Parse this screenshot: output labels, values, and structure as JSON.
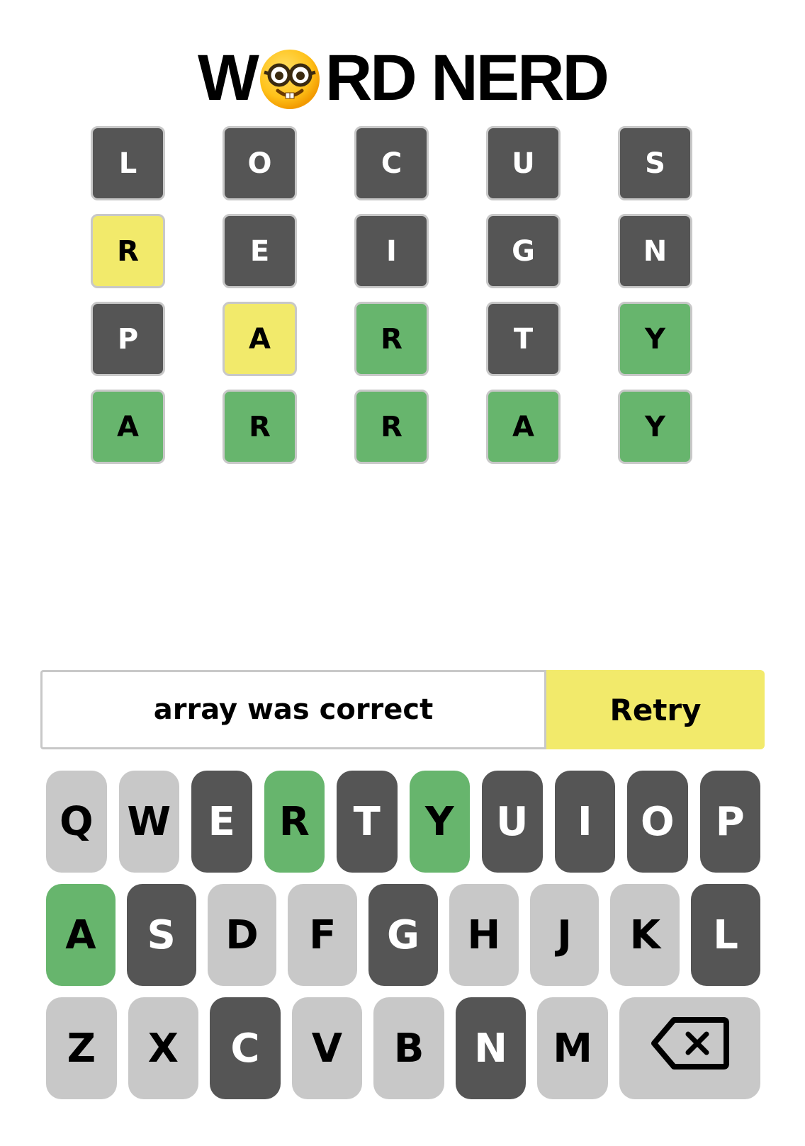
{
  "title": {
    "prefix": "W",
    "suffix": "RD NERD",
    "emoji_icon": "nerd-face-icon"
  },
  "colors": {
    "absent": "#555555",
    "present": "#f2ea6b",
    "correct": "#67b56d",
    "unused": "#c8c8c8"
  },
  "board": [
    [
      {
        "letter": "L",
        "state": "absent"
      },
      {
        "letter": "O",
        "state": "absent"
      },
      {
        "letter": "C",
        "state": "absent"
      },
      {
        "letter": "U",
        "state": "absent"
      },
      {
        "letter": "S",
        "state": "absent"
      }
    ],
    [
      {
        "letter": "R",
        "state": "present"
      },
      {
        "letter": "E",
        "state": "absent"
      },
      {
        "letter": "I",
        "state": "absent"
      },
      {
        "letter": "G",
        "state": "absent"
      },
      {
        "letter": "N",
        "state": "absent"
      }
    ],
    [
      {
        "letter": "P",
        "state": "absent"
      },
      {
        "letter": "A",
        "state": "present"
      },
      {
        "letter": "R",
        "state": "correct"
      },
      {
        "letter": "T",
        "state": "absent"
      },
      {
        "letter": "Y",
        "state": "correct"
      }
    ],
    [
      {
        "letter": "A",
        "state": "correct"
      },
      {
        "letter": "R",
        "state": "correct"
      },
      {
        "letter": "R",
        "state": "correct"
      },
      {
        "letter": "A",
        "state": "correct"
      },
      {
        "letter": "Y",
        "state": "correct"
      }
    ]
  ],
  "status": {
    "message": "array was correct",
    "retry_label": "Retry"
  },
  "keyboard": [
    [
      {
        "key": "Q",
        "state": "unused"
      },
      {
        "key": "W",
        "state": "unused"
      },
      {
        "key": "E",
        "state": "absent"
      },
      {
        "key": "R",
        "state": "correct"
      },
      {
        "key": "T",
        "state": "absent"
      },
      {
        "key": "Y",
        "state": "correct"
      },
      {
        "key": "U",
        "state": "absent"
      },
      {
        "key": "I",
        "state": "absent"
      },
      {
        "key": "O",
        "state": "absent"
      },
      {
        "key": "P",
        "state": "absent"
      }
    ],
    [
      {
        "key": "A",
        "state": "correct"
      },
      {
        "key": "S",
        "state": "absent"
      },
      {
        "key": "D",
        "state": "unused"
      },
      {
        "key": "F",
        "state": "unused"
      },
      {
        "key": "G",
        "state": "absent"
      },
      {
        "key": "H",
        "state": "unused"
      },
      {
        "key": "J",
        "state": "unused"
      },
      {
        "key": "K",
        "state": "unused"
      },
      {
        "key": "L",
        "state": "absent"
      }
    ],
    [
      {
        "key": "Z",
        "state": "unused"
      },
      {
        "key": "X",
        "state": "unused"
      },
      {
        "key": "C",
        "state": "absent"
      },
      {
        "key": "V",
        "state": "unused"
      },
      {
        "key": "B",
        "state": "unused"
      },
      {
        "key": "N",
        "state": "absent"
      },
      {
        "key": "M",
        "state": "unused"
      },
      {
        "key": "",
        "state": "unused",
        "icon": "backspace-icon"
      }
    ]
  ]
}
